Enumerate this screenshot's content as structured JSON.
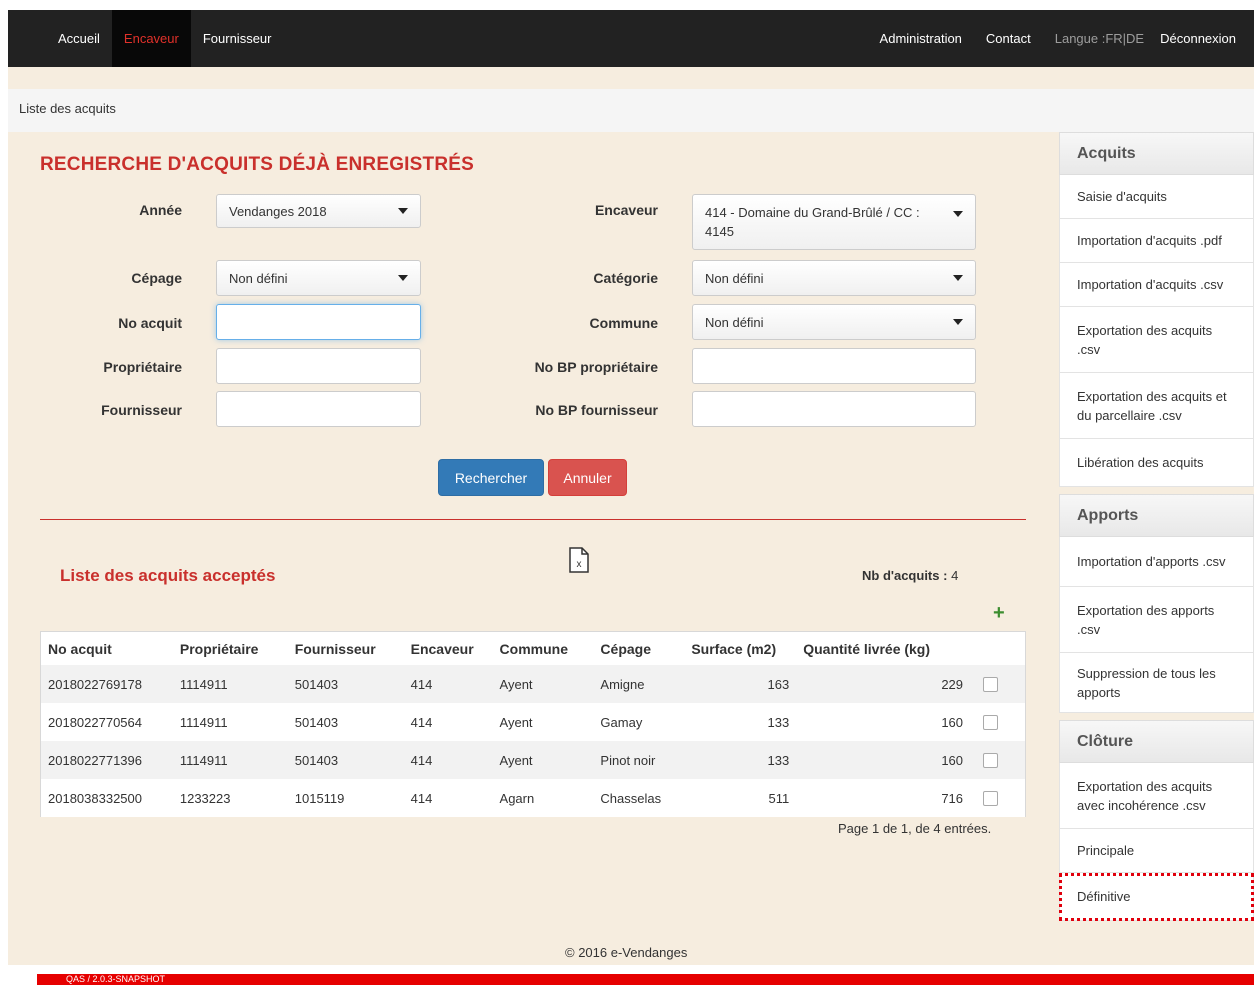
{
  "nav": {
    "left": [
      "Accueil",
      "Encaveur",
      "Fournisseur"
    ],
    "right": [
      "Administration",
      "Contact"
    ],
    "langue": "Langue :FR|DE",
    "logout": "Déconnexion"
  },
  "breadcrumb": "Liste des acquits",
  "search": {
    "title": "RECHERCHE D'ACQUITS DÉJÀ ENREGISTRÉS",
    "labels": {
      "annee": "Année",
      "encaveur": "Encaveur",
      "cepage": "Cépage",
      "categorie": "Catégorie",
      "no_acquit": "No acquit",
      "commune": "Commune",
      "proprietaire": "Propriétaire",
      "no_bp_proprietaire": "No BP propriétaire",
      "fournisseur": "Fournisseur",
      "no_bp_fournisseur": "No BP fournisseur"
    },
    "values": {
      "annee": "Vendanges 2018",
      "encaveur": "414 - Domaine du Grand-Brûlé / CC : 4145",
      "cepage": "Non défini",
      "categorie": "Non défini",
      "commune": "Non défini",
      "no_acquit": "",
      "proprietaire": "",
      "no_bp_proprietaire": "",
      "fournisseur": "",
      "no_bp_fournisseur": ""
    },
    "btn_search": "Rechercher",
    "btn_cancel": "Annuler"
  },
  "list": {
    "title": "Liste des acquits acceptés",
    "count_label": "Nb d'acquits :",
    "count_value": "4",
    "add_symbol": "+",
    "pagination": "Page 1 de 1, de 4 entrées.",
    "headers": [
      "No acquit",
      "Propriétaire",
      "Fournisseur",
      "Encaveur",
      "Commune",
      "Cépage",
      "Surface (m2)",
      "Quantité livrée (kg)"
    ],
    "rows": [
      {
        "no_acquit": "2018022769178",
        "proprietaire": "1114911",
        "fournisseur": "501403",
        "encaveur": "414",
        "commune": "Ayent",
        "cepage": "Amigne",
        "surface": "163",
        "quantite": "229"
      },
      {
        "no_acquit": "2018022770564",
        "proprietaire": "1114911",
        "fournisseur": "501403",
        "encaveur": "414",
        "commune": "Ayent",
        "cepage": "Gamay",
        "surface": "133",
        "quantite": "160"
      },
      {
        "no_acquit": "2018022771396",
        "proprietaire": "1114911",
        "fournisseur": "501403",
        "encaveur": "414",
        "commune": "Ayent",
        "cepage": "Pinot noir",
        "surface": "133",
        "quantite": "160"
      },
      {
        "no_acquit": "2018038332500",
        "proprietaire": "1233223",
        "fournisseur": "1015119",
        "encaveur": "414",
        "commune": "Agarn",
        "cepage": "Chasselas",
        "surface": "511",
        "quantite": "716"
      }
    ]
  },
  "sidebar": {
    "acquits": {
      "title": "Acquits",
      "items": [
        "Saisie d'acquits",
        "Importation d'acquits .pdf",
        "Importation d'acquits .csv",
        "Exportation des acquits .csv",
        "Exportation des acquits et du parcellaire .csv",
        "Libération des acquits"
      ]
    },
    "apports": {
      "title": "Apports",
      "items": [
        "Importation d'apports .csv",
        "Exportation des apports .csv",
        "Suppression de tous les apports"
      ]
    },
    "cloture": {
      "title": "Clôture",
      "items": [
        "Exportation des acquits avec incohérence .csv",
        "Principale",
        "Définitive"
      ]
    }
  },
  "footer": "© 2016 e-Vendanges",
  "version": "QAS / 2.0.3-SNAPSHOT",
  "colors": {
    "accent": "#c9302c",
    "primary": "#337ab7",
    "danger": "#d9534f",
    "navbar": "#222222",
    "background": "#f6eddf"
  }
}
